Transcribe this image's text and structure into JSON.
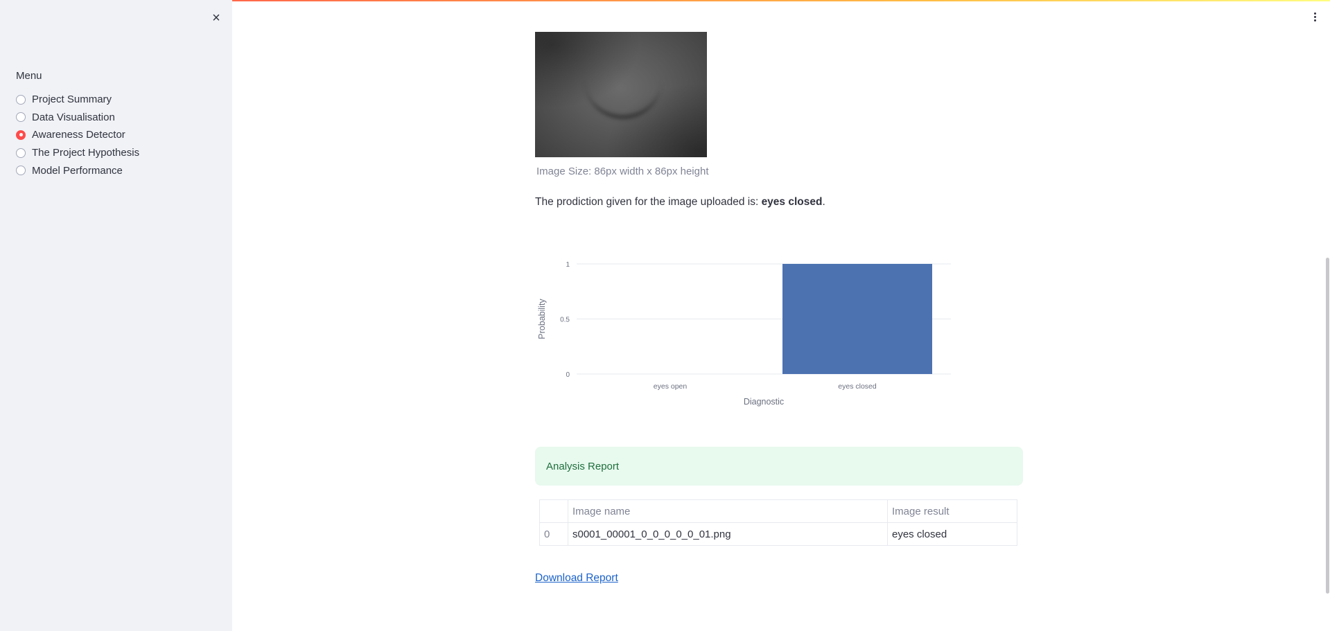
{
  "sidebar": {
    "close_icon": "×",
    "menu_label": "Menu",
    "items": [
      {
        "label": "Project Summary",
        "selected": false
      },
      {
        "label": "Data Visualisation",
        "selected": false
      },
      {
        "label": "Awareness Detector",
        "selected": true
      },
      {
        "label": "The Project Hypothesis",
        "selected": false
      },
      {
        "label": "Model Performance",
        "selected": false
      }
    ]
  },
  "main": {
    "image_caption": "Image Size: 86px width x 86px height",
    "prediction_prefix": "The prodiction given for the image uploaded is: ",
    "prediction_value": "eyes closed",
    "prediction_suffix": ".",
    "success_message": "Analysis Report",
    "table": {
      "headers": [
        "",
        "Image name",
        "Image result"
      ],
      "rows": [
        [
          "0",
          "s0001_00001_0_0_0_0_0_01.png",
          "eyes closed"
        ]
      ]
    },
    "download_label": "Download Report"
  },
  "colors": {
    "accent": "#ff4b4b",
    "bar": "#4c72b0",
    "success_bg": "#e8f9ee",
    "success_text": "#1f6f3d",
    "link": "#1b62c9"
  },
  "chart_data": {
    "type": "bar",
    "categories": [
      "eyes open",
      "eyes closed"
    ],
    "values": [
      0,
      1
    ],
    "xlabel": "Diagnostic",
    "ylabel": "Probability",
    "ylim": [
      0,
      1
    ],
    "yticks": [
      0,
      0.5,
      1
    ],
    "ytick_labels": [
      "0",
      "0.5",
      "1"
    ],
    "grid": true
  }
}
